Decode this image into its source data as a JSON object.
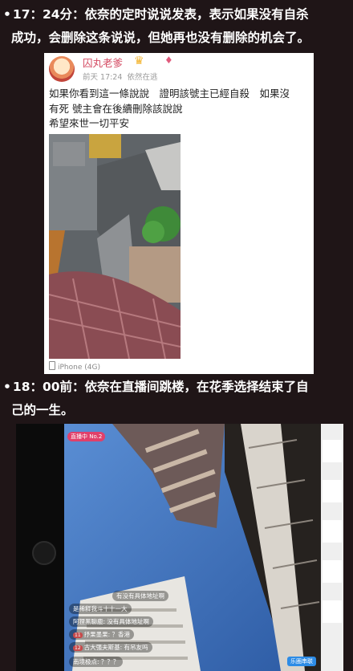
{
  "captions": {
    "first_line": "17：24分：依奈的定时说说发表，表示如果没有自杀",
    "first_cont": "成功，会删除这条说说，但她再也没有删除的机会了。",
    "second_line": "18：00前：依奈在直播间跳楼，在花季选择结束了自",
    "second_cont": "己的一生。",
    "bullet": "•"
  },
  "post": {
    "username": "囚丸老爹",
    "badges": [
      "♛",
      "♦"
    ],
    "time": "前天 17:24",
    "status": "依然在逃",
    "lines": [
      "如果你看到這一條說說　證明該號主已經自殺　如果沒",
      "有死 號主會在後續刪除該說說",
      "希望來世一切平安"
    ],
    "device": "iPhone (4G)"
  },
  "stream": {
    "live_tag": "直播中 No.2",
    "comments": [
      {
        "level": "",
        "text": "有没有具体地址啊"
      },
      {
        "level": "",
        "text": "是稀释我斗十十一大"
      },
      {
        "level": "",
        "text": "阿狸黑聊鹿: 没有具体地址啊"
      },
      {
        "level": "11",
        "text": "抒果墨果: ？香港"
      },
      {
        "level": "12",
        "text": "古大强夫斯基: 有吊友吗"
      },
      {
        "level": "",
        "text": "南境极点: ？？？"
      }
    ],
    "comment_button": "乐圈串联"
  },
  "colors": {
    "background": "#1f1517",
    "username": "#d44a62",
    "sky": "#3d6fb4"
  }
}
